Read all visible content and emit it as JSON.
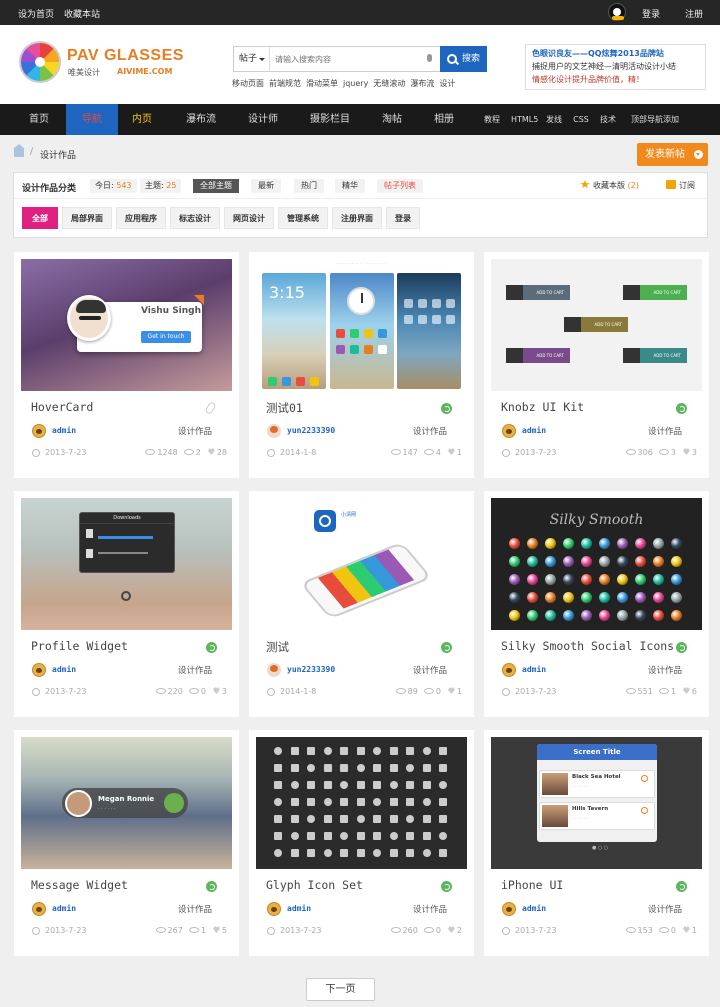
{
  "topbar": {
    "set_home": "设为首页",
    "bookmark": "收藏本站",
    "login": "登录",
    "register": "注册"
  },
  "header": {
    "brand_main": "PAV GLASSES",
    "brand_sub": "唯美设计",
    "brand_url": "AIVIME.COM",
    "search_type": "帖子",
    "search_placeholder": "请输入搜索内容",
    "search_button": "搜索",
    "hot_words": [
      "移动页面",
      "前端规范",
      "滑动菜单",
      "jquery",
      "无缝滚动",
      "瀑布流",
      "设计"
    ],
    "promo": [
      "色眼识良友——QQ炫舞2013品牌站",
      "捕捉用户的文艺神经—清明活动设计小结",
      "情感化设计提升品牌价值，精！"
    ]
  },
  "nav": [
    {
      "label": "首页"
    },
    {
      "label": "导航"
    },
    {
      "label": "内页"
    },
    {
      "label": "瀑布流"
    },
    {
      "label": "设计师"
    },
    {
      "label": "摄影栏目"
    },
    {
      "label": "淘帖"
    },
    {
      "label": "相册"
    },
    {
      "label": "教程"
    },
    {
      "label": "HTML5"
    },
    {
      "label": "发线"
    },
    {
      "label": "CSS"
    },
    {
      "label": "技术"
    },
    {
      "label": "顶部导航添加"
    }
  ],
  "breadcrumb": {
    "sep": "/",
    "current": "设计作品"
  },
  "new_post": "发表新帖",
  "filter": {
    "title": "设计作品分类",
    "today_label": "今日:",
    "today_value": "543",
    "topics_label": "主题:",
    "topics_value": "25",
    "tabs": [
      "全部主题",
      "最新",
      "热门",
      "精华",
      "帖子列表"
    ],
    "favorite_label": "收藏本版",
    "favorite_count": "(2)",
    "rss": "订阅",
    "categories": [
      "全部",
      "局部界面",
      "应用程序",
      "标志设计",
      "网页设计",
      "管理系统",
      "注册界面",
      "登录"
    ]
  },
  "cards": [
    {
      "title": "HoverCard",
      "author": "admin",
      "category": "设计作品",
      "date": "2013-7-23",
      "views": "1248",
      "replies": "2",
      "likes": "28",
      "thumb_text": [
        "Vishu Singh",
        "Get in touch"
      ]
    },
    {
      "title": "测试01",
      "author": "yun2233390",
      "category": "设计作品",
      "date": "2014-1-8",
      "views": "147",
      "replies": "4",
      "likes": "1",
      "thumb_text": [
        "3:15"
      ]
    },
    {
      "title": "Knobz UI Kit",
      "author": "admin",
      "category": "设计作品",
      "date": "2013-7-23",
      "views": "306",
      "replies": "3",
      "likes": "3",
      "thumb_text": [
        "ADD TO CART"
      ]
    },
    {
      "title": "Profile Widget",
      "author": "admin",
      "category": "设计作品",
      "date": "2013-7-23",
      "views": "220",
      "replies": "0",
      "likes": "3",
      "thumb_text": [
        "Downloads"
      ]
    },
    {
      "title": "测试",
      "author": "yun2233390",
      "category": "设计作品",
      "date": "2014-1-8",
      "views": "89",
      "replies": "0",
      "likes": "1",
      "thumb_text": [
        "小清网"
      ]
    },
    {
      "title": "Silky Smooth Social Icons",
      "author": "admin",
      "category": "设计作品",
      "date": "2013-7-23",
      "views": "551",
      "replies": "1",
      "likes": "6",
      "thumb_text": [
        "Silky Smooth"
      ]
    },
    {
      "title": "Message Widget",
      "author": "admin",
      "category": "设计作品",
      "date": "2013-7-23",
      "views": "267",
      "replies": "1",
      "likes": "5",
      "thumb_text": [
        "Megan Ronnie"
      ]
    },
    {
      "title": "Glyph Icon Set",
      "author": "admin",
      "category": "设计作品",
      "date": "2013-7-23",
      "views": "260",
      "replies": "0",
      "likes": "2",
      "thumb_text": []
    },
    {
      "title": "iPhone UI",
      "author": "admin",
      "category": "设计作品",
      "date": "2013-7-23",
      "views": "153",
      "replies": "0",
      "likes": "1",
      "thumb_text": [
        "Screen Title",
        "Black Sea Hotel",
        "Hills Tavern"
      ]
    }
  ],
  "pager": {
    "next": "下一页"
  }
}
